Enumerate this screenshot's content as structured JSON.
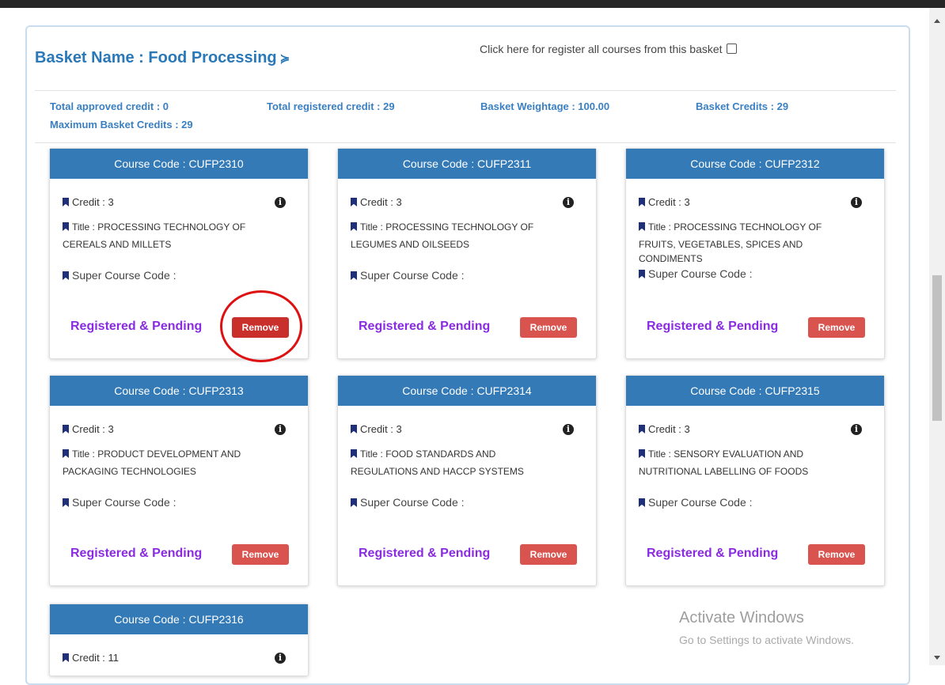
{
  "basket": {
    "name_label": "Basket Name : Food Processing",
    "chevron_glyph": "≽",
    "register_all_label": "Click here for register all courses from this basket",
    "register_all_checked": false,
    "stats": {
      "total_approved": "Total approved credit : 0",
      "total_registered": "Total registered credit : 29",
      "weightage": "Basket Weightage : 100.00",
      "basket_credits": "Basket Credits : 29",
      "max_credits": "Maximum Basket Credits : 29"
    }
  },
  "labels": {
    "super_course_code": "Super Course Code :",
    "status": "Registered & Pending",
    "remove": "Remove",
    "info_glyph": "i"
  },
  "courses": [
    {
      "code_label": "Course Code : CUFP2310",
      "credit": "Credit : 3",
      "title_line1": "Title : PROCESSING TECHNOLOGY OF",
      "title_line2": "CEREALS AND MILLETS"
    },
    {
      "code_label": "Course Code : CUFP2311",
      "credit": "Credit : 3",
      "title_line1": "Title : PROCESSING TECHNOLOGY OF",
      "title_line2": "LEGUMES AND OILSEEDS"
    },
    {
      "code_label": "Course Code : CUFP2312",
      "credit": "Credit : 3",
      "title_line1": "Title : PROCESSING TECHNOLOGY OF",
      "title_line2": "FRUITS, VEGETABLES, SPICES AND",
      "title_line3": "CONDIMENTS"
    },
    {
      "code_label": "Course Code : CUFP2313",
      "credit": "Credit : 3",
      "title_line1": "Title : PRODUCT DEVELOPMENT AND",
      "title_line2": "PACKAGING TECHNOLOGIES"
    },
    {
      "code_label": "Course Code : CUFP2314",
      "credit": "Credit : 3",
      "title_line1": "Title : FOOD STANDARDS AND",
      "title_line2": "REGULATIONS AND HACCP SYSTEMS"
    },
    {
      "code_label": "Course Code : CUFP2315",
      "credit": "Credit : 3",
      "title_line1": "Title : SENSORY EVALUATION AND",
      "title_line2": "NUTRITIONAL LABELLING OF FOODS"
    },
    {
      "code_label": "Course Code : CUFP2316",
      "credit": "Credit : 11"
    }
  ],
  "watermark": {
    "line1": "Activate Windows",
    "line2": "Go to Settings to activate Windows."
  },
  "colors": {
    "accent_blue": "#337ab7",
    "remove_red": "#d9534f",
    "status_purple": "#8a2be2",
    "annotation_circle": "#d11111"
  }
}
